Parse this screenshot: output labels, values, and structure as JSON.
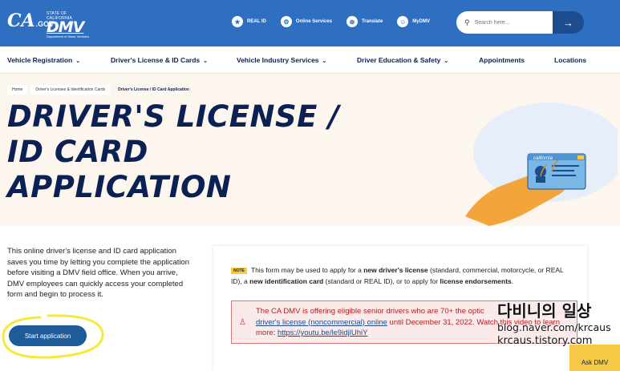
{
  "header": {
    "ca_logo": "CA",
    "ca_logo_suffix": ".GOV",
    "dmv_state": "STATE OF CALIFORNIA",
    "dmv_word": "DMV",
    "dmv_dept": "Department of Motor Vehicles",
    "links": [
      {
        "label": "REAL ID",
        "icon": "star-icon"
      },
      {
        "label": "Online Services",
        "icon": "gear-icon"
      },
      {
        "label": "Translate",
        "icon": "globe-icon"
      },
      {
        "label": "MyDMV",
        "icon": "user-icon"
      }
    ],
    "search_placeholder": "Search here...",
    "search_go": "→"
  },
  "nav": {
    "items": [
      {
        "label": "Vehicle Registration",
        "caret": "⌄"
      },
      {
        "label": "Driver's License & ID Cards",
        "caret": "⌄"
      },
      {
        "label": "Vehicle Industry Services",
        "caret": "⌄"
      },
      {
        "label": "Driver Education & Safety",
        "caret": "⌄"
      },
      {
        "label": "Appointments",
        "caret": ""
      },
      {
        "label": "Locations",
        "caret": ""
      }
    ]
  },
  "breadcrumb": [
    "Home",
    "Driver's Licenses & Identification Cards",
    "Driver's License / ID Card Application"
  ],
  "title": {
    "line1": "DRIVER'S LICENSE /",
    "line2": "ID CARD",
    "line3": "APPLICATION"
  },
  "hero_card": {
    "label": "california"
  },
  "intro": "This online driver's license and ID card application saves you time by letting you complete the application before visiting a DMV field office. When you arrive, DMV employees can quickly access your completed form and begin to process it.",
  "start_button": "Start application",
  "note": {
    "tag": "NOTE",
    "text_a": "This form may be used to apply for a ",
    "bold_a": "new driver's license",
    "text_b": " (standard, commercial, motorcycle, or REAL ID), a ",
    "bold_b": "new identification card",
    "text_c": " (standard or REAL ID), or to apply for ",
    "bold_c": "license endorsements",
    "text_d": "."
  },
  "alert": {
    "text_a": "The CA DMV is offering eligible senior drivers who are 70+ the optic",
    "link_a": "driver's license (noncommercial) online",
    "text_b": " until December 31, 2022. Watch this video to learn more: ",
    "link_b": "https://youtu.be/le9idjlUhiY"
  },
  "watermark": {
    "line1": "다비니의 일상",
    "line2": "blog.naver.com/krcaus",
    "line3": "krcaus.tistory.com"
  },
  "ask_dmv": "Ask DMV",
  "colors": {
    "brand_blue": "#2f6fc1",
    "navy": "#0b2154",
    "accent_yellow": "#f6c946",
    "alert_red": "#b32020"
  }
}
